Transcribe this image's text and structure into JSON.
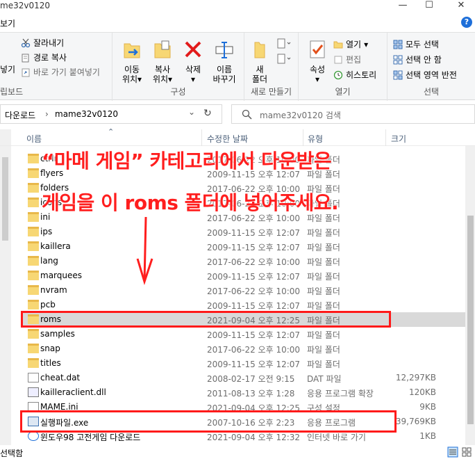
{
  "window": {
    "title": "me32v0120",
    "minimize": "—",
    "maximize": "☐",
    "close": "✕"
  },
  "menu": {
    "tab_view": "보기",
    "help_icon": "?"
  },
  "ribbon": {
    "clipboard": {
      "label": "립보드",
      "cut": "잘라내기",
      "copy_path": "경로 복사",
      "paste_shortcut": "바로 가기 붙여넣기",
      "paste_left": "넣기"
    },
    "organize": {
      "label": "구성",
      "move_line1": "이동",
      "move_line2": "위치",
      "copy_line1": "복사",
      "copy_line2": "위치",
      "delete": "삭제",
      "rename_line1": "이름",
      "rename_line2": "바꾸기",
      "dropdown": "▾"
    },
    "new": {
      "label": "새로 만들기",
      "new_folder_line1": "새",
      "new_folder_line2": "폴더"
    },
    "open": {
      "label": "열기",
      "properties": "속성",
      "open": "열기",
      "edit": "편집",
      "history": "히스토리"
    },
    "select": {
      "label": "선택",
      "select_all": "모두 선택",
      "select_none": "선택 안 함",
      "invert": "선택 영역 반전"
    }
  },
  "address": {
    "crumb1": "다운로드",
    "sep": "›",
    "crumb2": "mame32v0120",
    "chevron": "⌄",
    "refresh": "↻",
    "search_placeholder": "mame32v0120 검색"
  },
  "columns": {
    "name": "이름",
    "date": "수정한 날짜",
    "type": "유형",
    "size": "크기",
    "sort_arrow": "⌃"
  },
  "files": [
    {
      "name": "ctrlr",
      "date": "2017-06-22 오후 10:00",
      "type": "파일 폴더",
      "size": "",
      "kind": "folder"
    },
    {
      "name": "flyers",
      "date": "2009-11-15 오후 12:07",
      "type": "파일 폴더",
      "size": "",
      "kind": "folder"
    },
    {
      "name": "folders",
      "date": "2017-06-22 오후 10:00",
      "type": "파일 폴더",
      "size": "",
      "kind": "folder"
    },
    {
      "name": "icons",
      "date": "2017-06-22 오후 10:00",
      "type": "파일 폴더",
      "size": "",
      "kind": "folder"
    },
    {
      "name": "ini",
      "date": "2017-06-22 오후 10:00",
      "type": "파일 폴더",
      "size": "",
      "kind": "folder"
    },
    {
      "name": "ips",
      "date": "2009-11-15 오후 12:07",
      "type": "파일 폴더",
      "size": "",
      "kind": "folder"
    },
    {
      "name": "kaillera",
      "date": "2009-11-15 오후 12:07",
      "type": "파일 폴더",
      "size": "",
      "kind": "folder"
    },
    {
      "name": "lang",
      "date": "2017-06-22 오후 10:00",
      "type": "파일 폴더",
      "size": "",
      "kind": "folder"
    },
    {
      "name": "marquees",
      "date": "2009-11-15 오후 12:07",
      "type": "파일 폴더",
      "size": "",
      "kind": "folder"
    },
    {
      "name": "nvram",
      "date": "2017-06-22 오후 10:00",
      "type": "파일 폴더",
      "size": "",
      "kind": "folder"
    },
    {
      "name": "pcb",
      "date": "2009-11-15 오후 12:07",
      "type": "파일 폴더",
      "size": "",
      "kind": "folder"
    },
    {
      "name": "roms",
      "date": "2021-09-04 오후 12:25",
      "type": "파일 폴더",
      "size": "",
      "kind": "folder"
    },
    {
      "name": "samples",
      "date": "2009-11-15 오후 12:07",
      "type": "파일 폴더",
      "size": "",
      "kind": "folder"
    },
    {
      "name": "snap",
      "date": "2017-06-22 오후 10:00",
      "type": "파일 폴더",
      "size": "",
      "kind": "folder"
    },
    {
      "name": "titles",
      "date": "2009-11-15 오후 12:07",
      "type": "파일 폴더",
      "size": "",
      "kind": "folder"
    },
    {
      "name": "cheat.dat",
      "date": "2008-02-17 오전 9:15",
      "type": "DAT 파일",
      "size": "12,297KB",
      "kind": "file"
    },
    {
      "name": "kailleraclient.dll",
      "date": "2011-08-13 오후 1:28",
      "type": "응용 프로그램 확장",
      "size": "120KB",
      "kind": "dll"
    },
    {
      "name": "MAME.ini",
      "date": "2021-09-04 오후 12:25",
      "type": "구성 설정",
      "size": "9KB",
      "kind": "file"
    },
    {
      "name": "실행파일.exe",
      "date": "2007-10-16 오후 2:23",
      "type": "응용 프로그램",
      "size": "39,769KB",
      "kind": "exe"
    },
    {
      "name": "윈도우98 고전게임 다운로드",
      "date": "2021-09-04 오후 12:32",
      "type": "인터넷 바로 가기",
      "size": "1KB",
      "kind": "url"
    }
  ],
  "status": {
    "text": "선택함"
  },
  "annotation": {
    "line1": "“마메 게임” 카테고리에서 다운받은",
    "line2": "게임을 이 roms 폴더에 넣어주세요."
  },
  "colors": {
    "annotation_red": "#ff1e1e",
    "selected_row": "#d9d9d9",
    "folder_yellow": "#f7d774"
  }
}
